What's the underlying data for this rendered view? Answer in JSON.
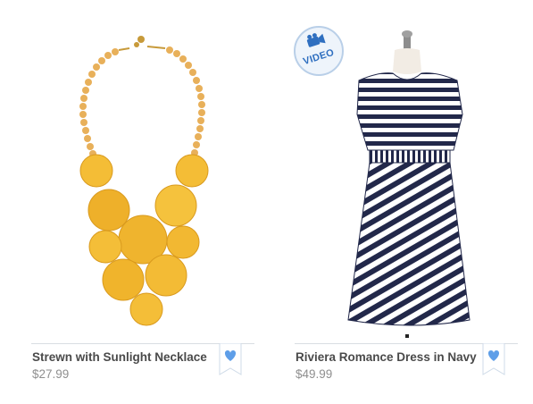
{
  "products": [
    {
      "name": "Strewn with Sunlight Necklace",
      "price": "$27.99",
      "image_icon": "necklace-image",
      "has_video": false
    },
    {
      "name": "Riviera Romance Dress in Navy",
      "price": "$49.99",
      "image_icon": "dress-image",
      "has_video": true,
      "video_label": "VIDEO"
    }
  ],
  "colors": {
    "name_text": "#4a4a4a",
    "price_text": "#8f8f8f",
    "wishlist_blue": "#5e9ee8",
    "video_blue": "#2f6fc0",
    "necklace_yellow": "#f2b631",
    "dress_navy": "#22284a"
  }
}
